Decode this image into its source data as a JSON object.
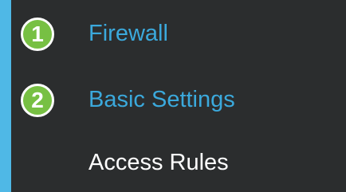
{
  "menu": {
    "items": [
      {
        "step": "1",
        "label": "Firewall"
      },
      {
        "step": "2",
        "label": "Basic Settings"
      },
      {
        "label": "Access Rules"
      }
    ]
  },
  "colors": {
    "background": "#2b2d2e",
    "accent_bar": "#4fb8e6",
    "link_text": "#3ba9dc",
    "plain_text": "#ffffff",
    "step_badge": "#77c043"
  }
}
